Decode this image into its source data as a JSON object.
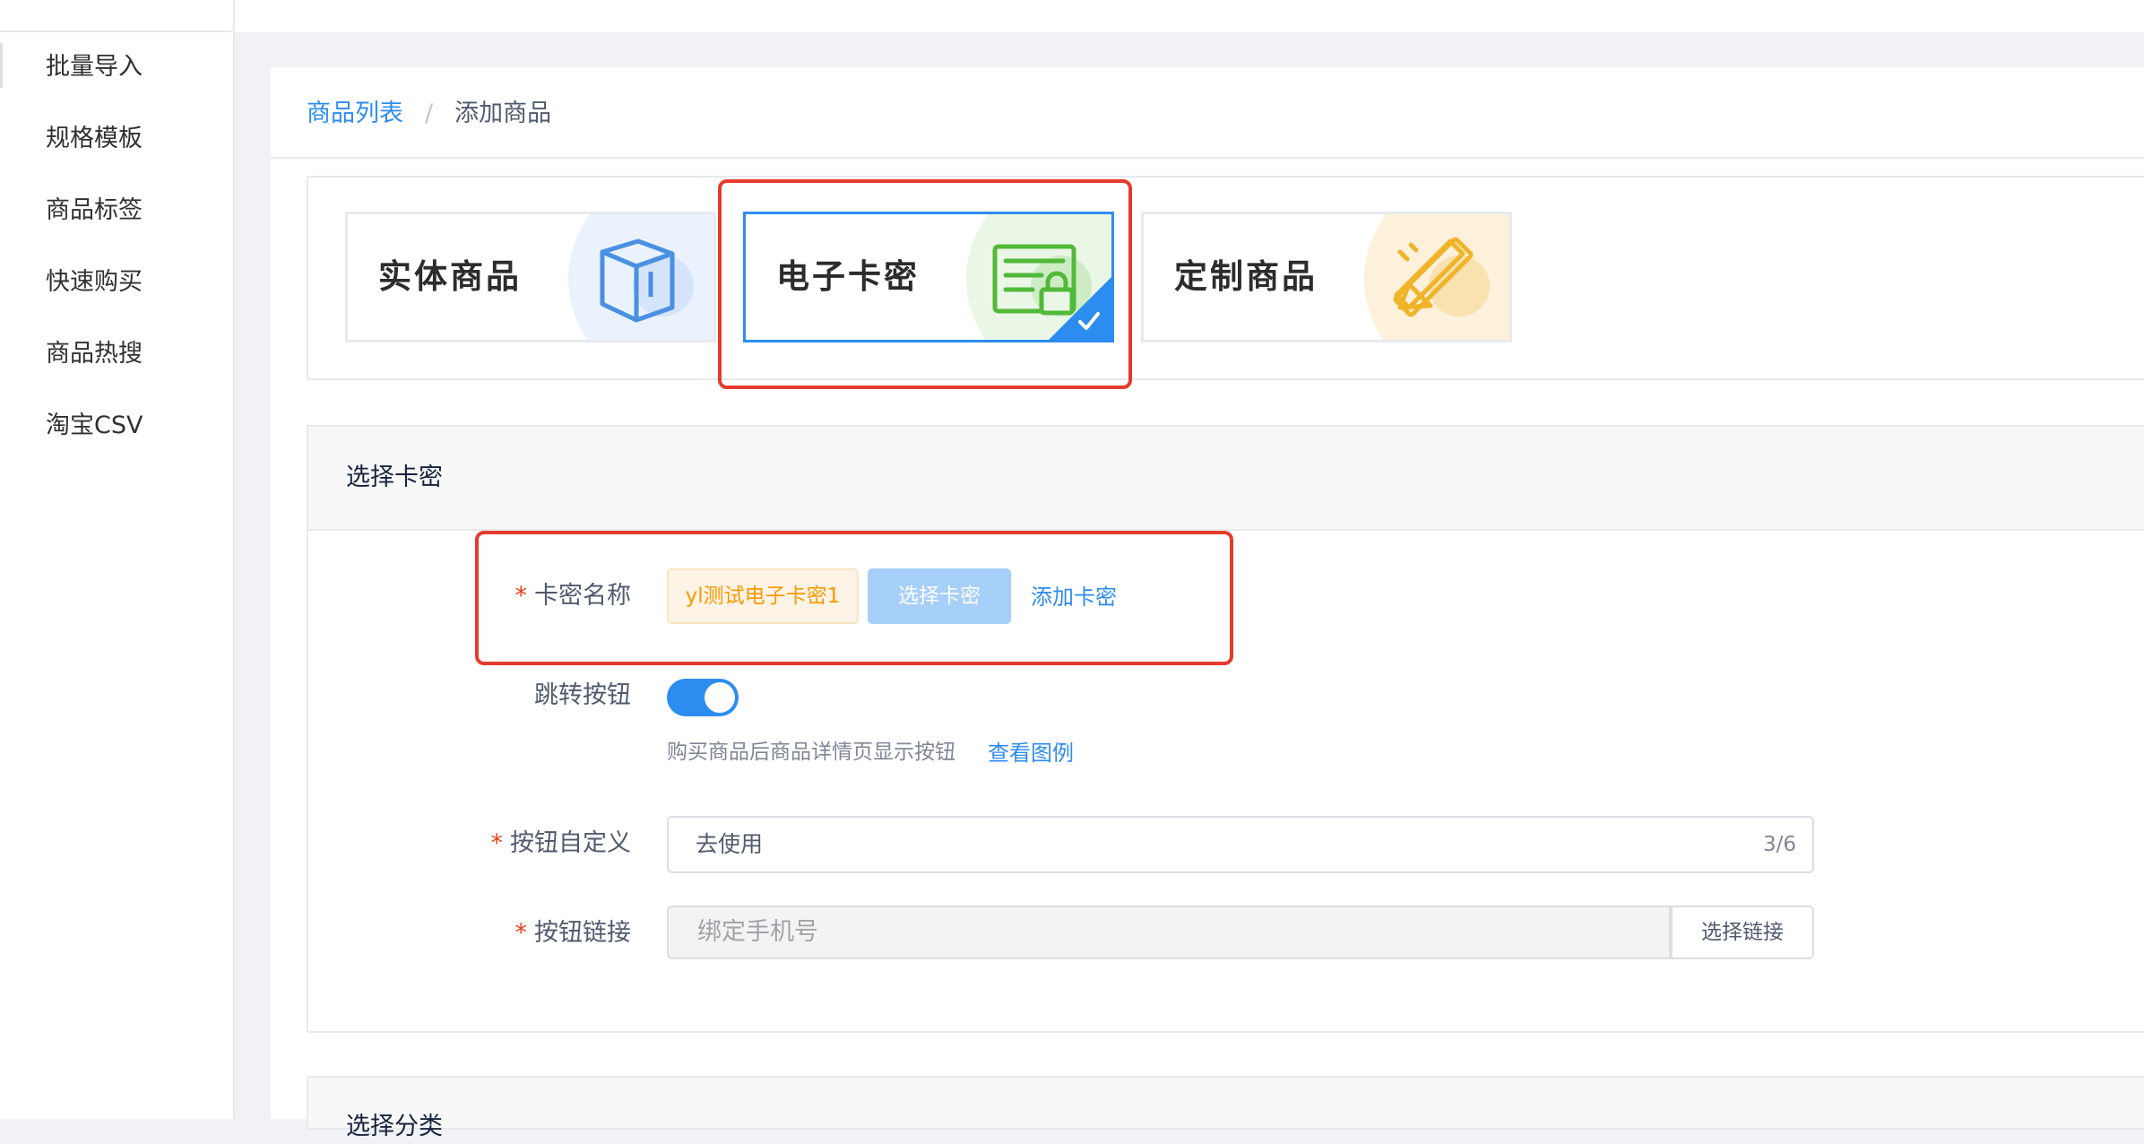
{
  "sidebar": {
    "items": [
      {
        "label": "批量导入"
      },
      {
        "label": "规格模板"
      },
      {
        "label": "商品标签"
      },
      {
        "label": "快速购买"
      },
      {
        "label": "商品热搜"
      },
      {
        "label": "淘宝CSV"
      }
    ]
  },
  "breadcrumb": {
    "parent": "商品列表",
    "separator": "/",
    "current": "添加商品"
  },
  "product_types": [
    {
      "label": "实体商品",
      "icon": "box-icon",
      "accent": "#4a90e2"
    },
    {
      "label": "电子卡密",
      "icon": "card-lock-icon",
      "accent": "#52b93a",
      "selected": true
    },
    {
      "label": "定制商品",
      "icon": "pencil-ruler-icon",
      "accent": "#f0b429"
    }
  ],
  "section": {
    "title": "选择卡密",
    "card_name": {
      "label": "卡密名称",
      "value": "yl测试电子卡密1",
      "select_button": "选择卡密",
      "add_link": "添加卡密"
    },
    "jump_button": {
      "label": "跳转按钮",
      "enabled": true,
      "hint": "购买商品后商品详情页显示按钮",
      "example_link": "查看图例"
    },
    "button_custom": {
      "label": "按钮自定义",
      "value": "去使用",
      "count": "3/6"
    },
    "button_link": {
      "label": "按钮链接",
      "placeholder": "绑定手机号",
      "select_button": "选择链接"
    }
  },
  "section2": {
    "title": "选择分类"
  },
  "colors": {
    "primary": "#2d8cf0",
    "highlight": "#e53b2c",
    "required": "#ed4014",
    "tag_orange": "#ff9900"
  }
}
